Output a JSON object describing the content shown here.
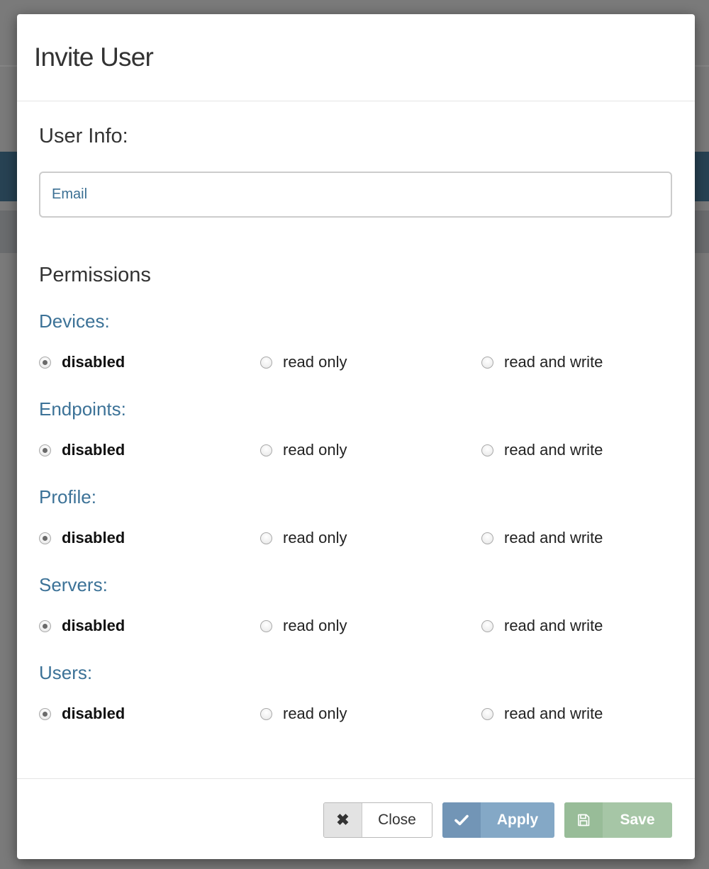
{
  "modal": {
    "title": "Invite User",
    "user_info_title": "User Info:",
    "email_placeholder": "Email",
    "email_value": "",
    "permissions_title": "Permissions"
  },
  "options": {
    "disabled": "disabled",
    "read_only": "read only",
    "read_write": "read and write"
  },
  "permissions": [
    {
      "label": "Devices:",
      "selected": "disabled"
    },
    {
      "label": "Endpoints:",
      "selected": "disabled"
    },
    {
      "label": "Profile:",
      "selected": "disabled"
    },
    {
      "label": "Servers:",
      "selected": "disabled"
    },
    {
      "label": "Users:",
      "selected": "disabled"
    }
  ],
  "footer": {
    "close_label": "Close",
    "apply_label": "Apply",
    "save_label": "Save"
  },
  "colors": {
    "accent_blue": "#3c7297",
    "apply_button": "#84a8c6",
    "save_button": "#a6c6a6"
  },
  "icons": {
    "close": "close-icon",
    "apply": "check-icon",
    "save": "floppy-disk-icon",
    "radio_selected": "radio-selected",
    "radio_unselected": "radio-unselected"
  }
}
